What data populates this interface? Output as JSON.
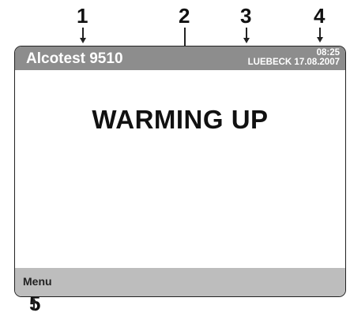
{
  "callouts": {
    "c1": "1",
    "c2": "2",
    "c3": "3",
    "c4": "4",
    "c5": "5"
  },
  "title_bar": {
    "app_name": "Alcotest 9510",
    "time": "08:25",
    "location_date": "LUEBECK 17.08.2007"
  },
  "main": {
    "status": "WARMING UP"
  },
  "softkey_bar": {
    "menu_label": "Menu"
  },
  "colors": {
    "title_bar": "#8d8d8d",
    "softkey_bar": "#bdbdbd"
  }
}
